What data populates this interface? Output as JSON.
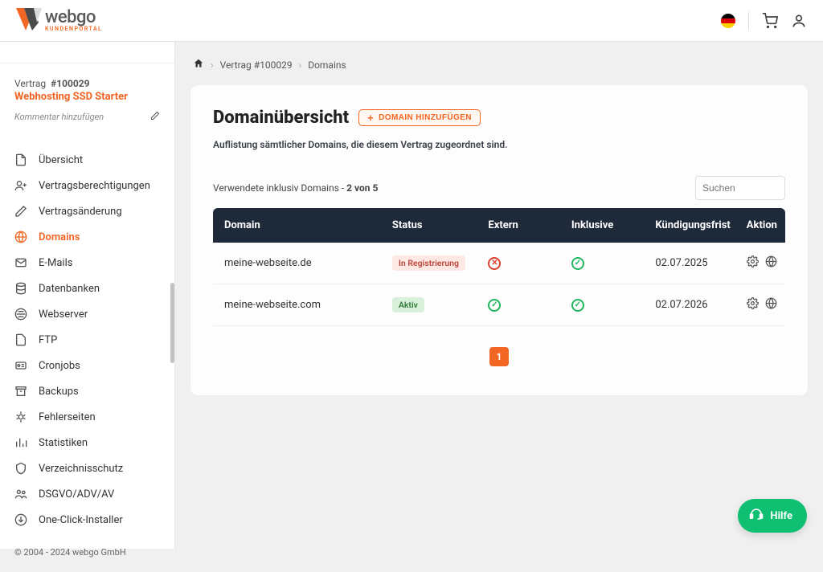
{
  "brand": {
    "name": "webgo",
    "sub": "KUNDENPORTAL"
  },
  "topbar": {
    "lang_icon": "flag-de",
    "cart_icon": "cart-icon",
    "user_icon": "user-icon"
  },
  "sidebar": {
    "contract_label": "Vertrag",
    "contract_number": "#100029",
    "contract_product": "Webhosting SSD Starter",
    "comment_placeholder": "Kommentar hinzufügen",
    "items": [
      {
        "key": "overview",
        "label": "Übersicht",
        "icon": "file-icon"
      },
      {
        "key": "perm",
        "label": "Vertragsberechtigungen",
        "icon": "user-plus-icon"
      },
      {
        "key": "change",
        "label": "Vertragsänderung",
        "icon": "edit-icon"
      },
      {
        "key": "domains",
        "label": "Domains",
        "icon": "globe-icon",
        "active": true
      },
      {
        "key": "emails",
        "label": "E-Mails",
        "icon": "mail-icon"
      },
      {
        "key": "db",
        "label": "Datenbanken",
        "icon": "database-icon"
      },
      {
        "key": "web",
        "label": "Webserver",
        "icon": "server-icon"
      },
      {
        "key": "ftp",
        "label": "FTP",
        "icon": "folder-icon"
      },
      {
        "key": "cron",
        "label": "Cronjobs",
        "icon": "clock-icon"
      },
      {
        "key": "backup",
        "label": "Backups",
        "icon": "archive-icon"
      },
      {
        "key": "error",
        "label": "Fehlerseiten",
        "icon": "bug-icon"
      },
      {
        "key": "stats",
        "label": "Statistiken",
        "icon": "stats-icon"
      },
      {
        "key": "protect",
        "label": "Verzeichnisschutz",
        "icon": "shield-icon"
      },
      {
        "key": "dsgvo",
        "label": "DSGVO/ADV/AV",
        "icon": "users-icon"
      },
      {
        "key": "oneclick",
        "label": "One-Click-Installer",
        "icon": "download-icon"
      }
    ],
    "copyright": "© 2004 - 2024 webgo GmbH"
  },
  "breadcrumb": {
    "home": "home-icon",
    "items": [
      "Vertrag #100029",
      "Domains"
    ]
  },
  "panel": {
    "title": "Domainübersicht",
    "add_button": "DOMAIN HINZUFÜGEN",
    "subtitle": "Auflistung sämtlicher Domains, die diesem Vertrag zugeordnet sind.",
    "used_prefix": "Verwendete inklusiv Domains - ",
    "used_value": "2 von 5",
    "search_placeholder": "Suchen",
    "columns": {
      "domain": "Domain",
      "status": "Status",
      "extern": "Extern",
      "inklusive": "Inklusive",
      "frist": "Kündigungsfrist",
      "aktion": "Aktion"
    },
    "rows": [
      {
        "domain": "meine-webseite.de",
        "status": "In Registrierung",
        "status_kind": "reg",
        "extern": false,
        "inklusive": true,
        "frist": "02.07.2025"
      },
      {
        "domain": "meine-webseite.com",
        "status": "Aktiv",
        "status_kind": "act",
        "extern": true,
        "inklusive": true,
        "frist": "02.07.2026"
      }
    ],
    "page": "1"
  },
  "help": {
    "label": "Hilfe"
  }
}
